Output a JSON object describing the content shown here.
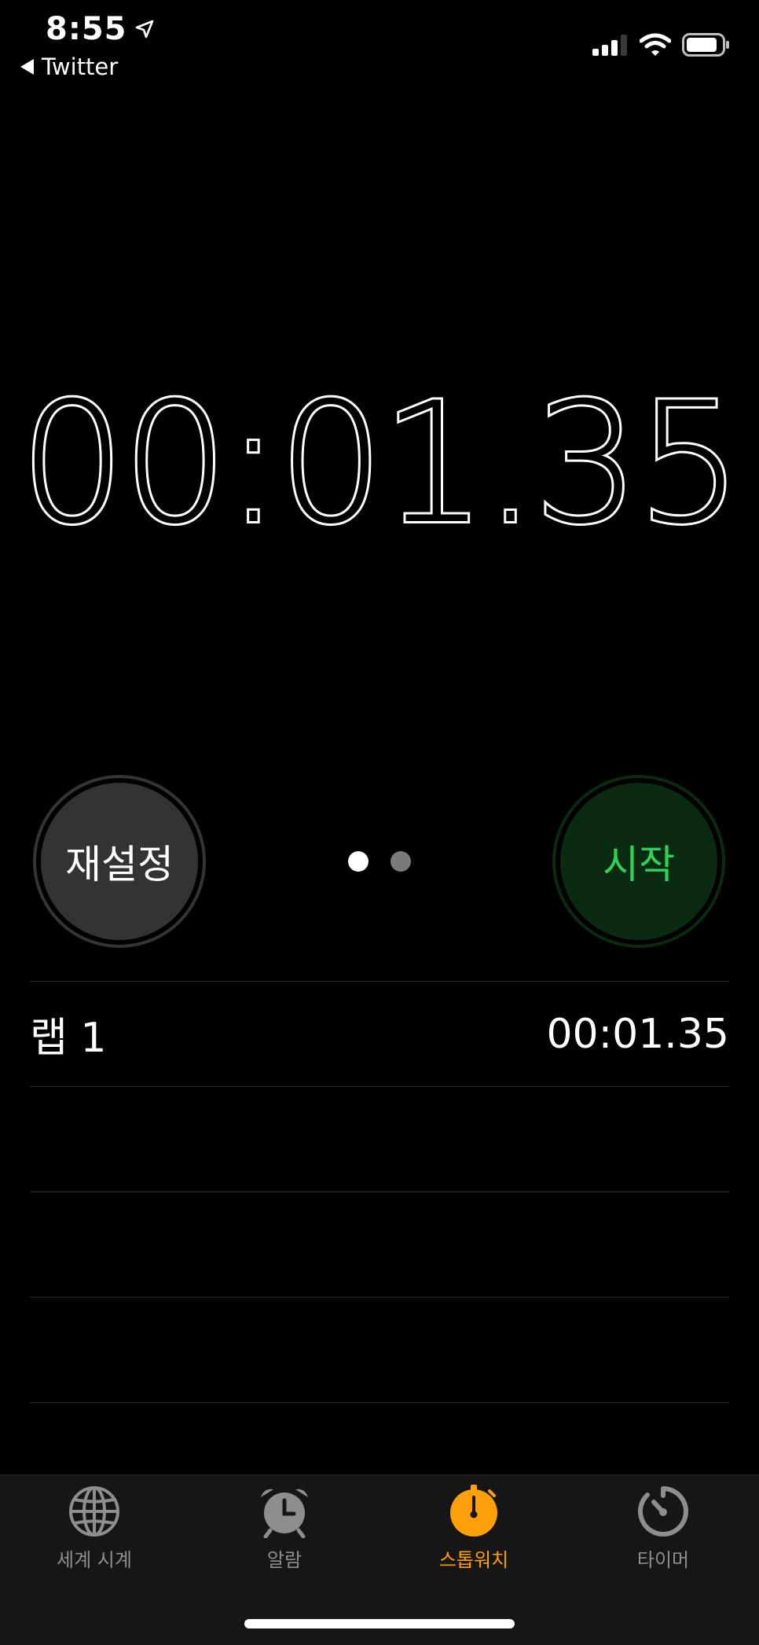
{
  "status_bar": {
    "time": "8:55",
    "back_app": "Twitter",
    "icons": [
      "location-arrow-icon",
      "cellular-signal-icon",
      "wifi-icon",
      "battery-icon"
    ]
  },
  "timer": {
    "display": "00:01.35"
  },
  "controls": {
    "reset_label": "재설정",
    "start_label": "시작",
    "page_count": 2,
    "active_page": 1
  },
  "laps": [
    {
      "label": "랩 1",
      "time": "00:01.35"
    }
  ],
  "tab_bar": {
    "tabs": [
      {
        "label": "세계 시계",
        "icon": "globe-icon",
        "active": false
      },
      {
        "label": "알람",
        "icon": "alarm-clock-icon",
        "active": false
      },
      {
        "label": "스톱워치",
        "icon": "stopwatch-icon",
        "active": true
      },
      {
        "label": "타이머",
        "icon": "timer-icon",
        "active": false
      }
    ]
  },
  "colors": {
    "background": "#000000",
    "start_green": "#30d158",
    "accent_orange": "#ff9f0a",
    "inactive_gray": "#8e8e8e"
  }
}
